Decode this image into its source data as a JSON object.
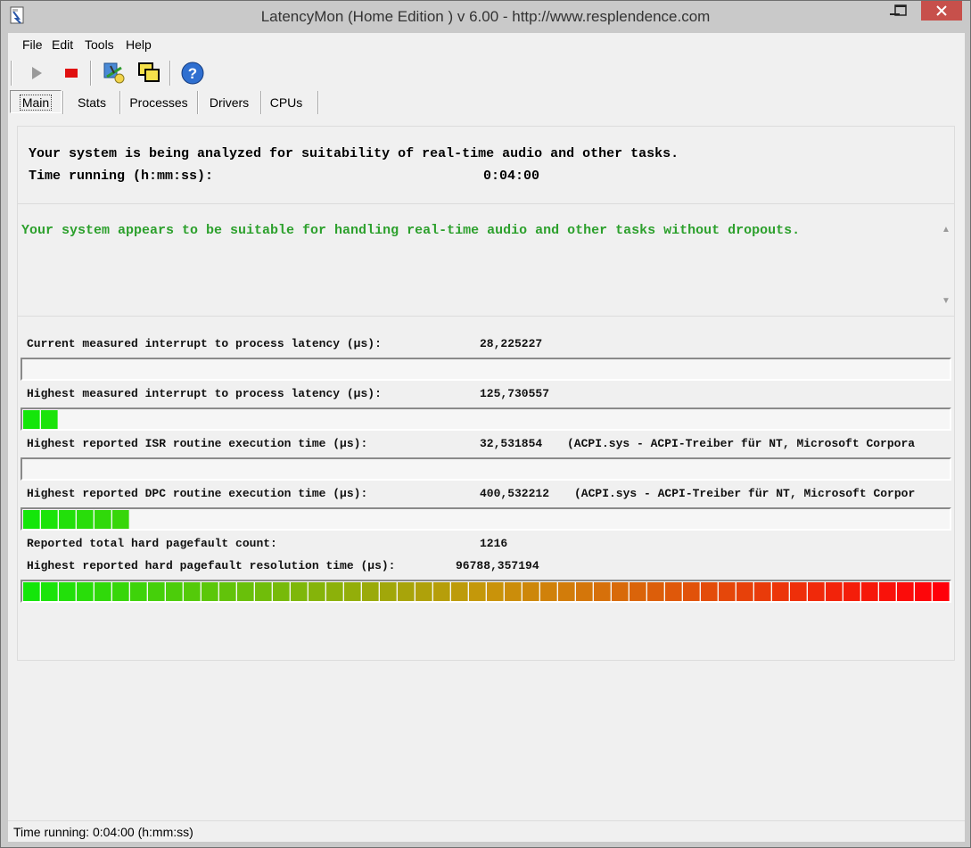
{
  "window": {
    "title": "LatencyMon  (Home Edition )  v 6.00 - http://www.resplendence.com",
    "status": "Time running: 0:04:00  (h:mm:ss)"
  },
  "menu": {
    "items": [
      "File",
      "Edit",
      "Tools",
      "Help"
    ]
  },
  "toolbar": {
    "start_icon": "play-icon",
    "stop_icon": "stop-icon",
    "analyze_icon": "analyze-icon",
    "windows_icon": "windows-icon",
    "help_icon": "help-icon"
  },
  "tabs": [
    "Main",
    "Stats",
    "Processes",
    "Drivers",
    "CPUs"
  ],
  "analysis": {
    "line1": "Your system is being analyzed for suitability of real-time audio and other tasks.",
    "time_label": "Time running (h:mm:ss):",
    "time_value": "0:04:00"
  },
  "verdict": {
    "message": "Your system appears to be suitable for handling real-time audio and other tasks without dropouts.",
    "color": "#2ca02c"
  },
  "metrics": {
    "current_latency": {
      "label": "Current measured interrupt to process latency (µs):",
      "value": "28,225227",
      "bar_fraction": 0.0
    },
    "highest_latency": {
      "label": "Highest measured interrupt to process latency (µs):",
      "value": "125,730557",
      "bar_fraction": 0.038
    },
    "highest_isr": {
      "label": "Highest reported ISR routine execution time (µs):",
      "value": "32,531854",
      "driver": "(ACPI.sys - ACPI-Treiber für NT, Microsoft Corpora",
      "bar_fraction": 0.0
    },
    "highest_dpc": {
      "label": "Highest reported DPC routine execution time (µs):",
      "value": "400,532212",
      "driver": "(ACPI.sys - ACPI-Treiber für NT, Microsoft Corpor",
      "bar_fraction": 0.115
    },
    "pagefault_count": {
      "label": "Reported total hard pagefault count:",
      "value": "1216"
    },
    "pagefault_time": {
      "label": "Highest reported hard pagefault resolution time (µs):",
      "value": "96788,357194",
      "bar_fraction": 1.0
    }
  }
}
